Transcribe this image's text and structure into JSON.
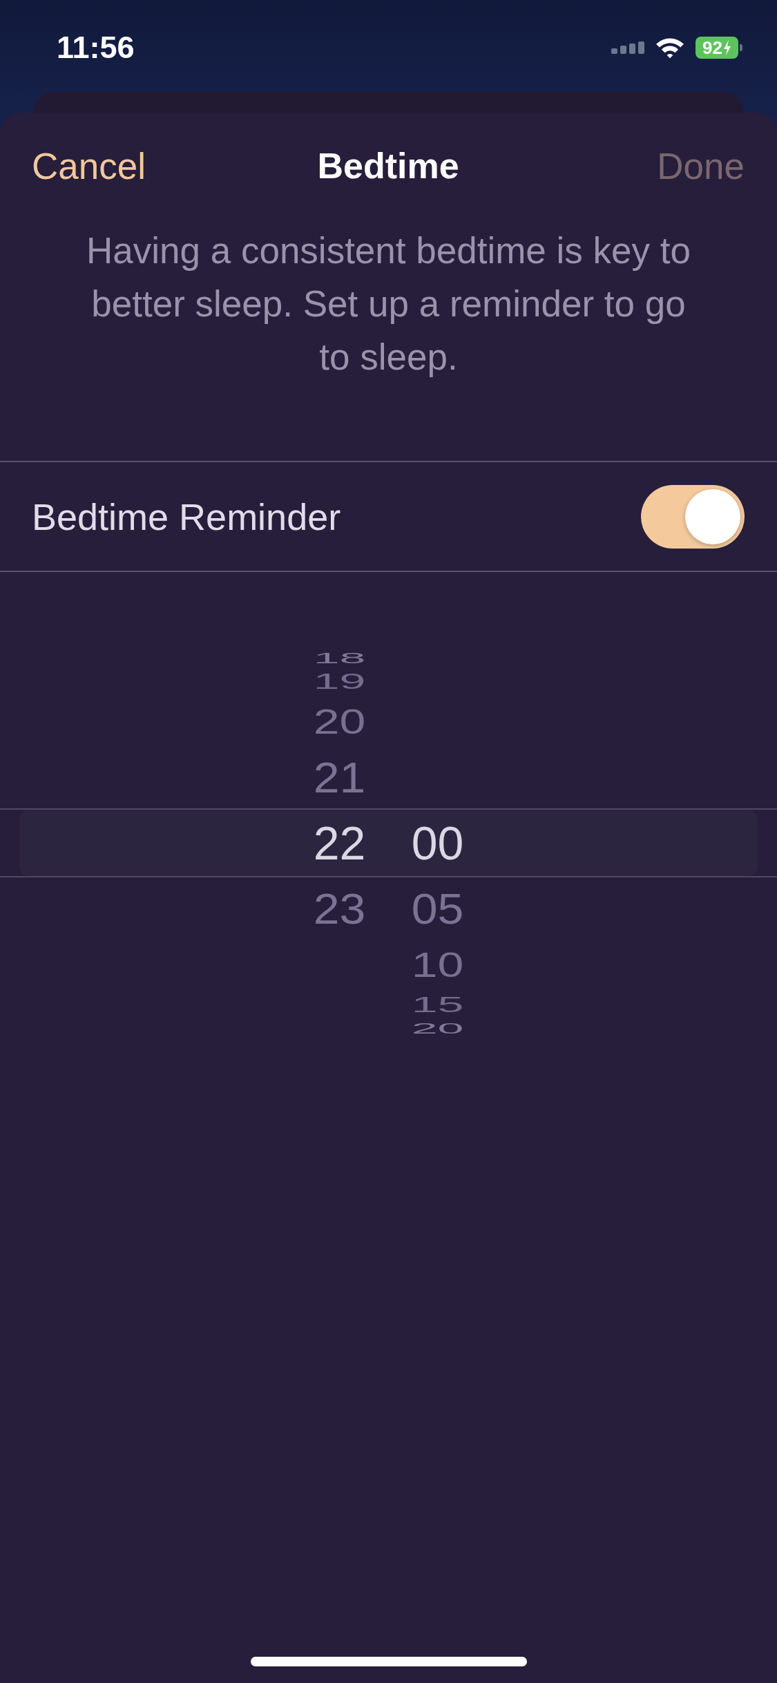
{
  "status_bar": {
    "time": "11:56",
    "battery_percent": "92",
    "charging": true
  },
  "sheet": {
    "cancel": "Cancel",
    "title": "Bedtime",
    "done": {
      "label": "Done",
      "disabled": true
    }
  },
  "description": "Having a consistent bedtime is key to better sleep. Set up a reminder to go to sleep.",
  "reminder": {
    "label": "Bedtime Reminder",
    "on": true
  },
  "picker": {
    "columns": [
      {
        "items": [
          {
            "value": "18",
            "selected": false
          },
          {
            "value": "19",
            "selected": false
          },
          {
            "value": "20",
            "selected": false
          },
          {
            "value": "21",
            "selected": false
          },
          {
            "value": "22",
            "selected": true
          },
          {
            "value": "23",
            "selected": false
          }
        ]
      },
      {
        "items": [
          {
            "value": "00",
            "selected": true
          },
          {
            "value": "05",
            "selected": false
          },
          {
            "value": "10",
            "selected": false
          },
          {
            "value": "15",
            "selected": false
          },
          {
            "value": "20",
            "selected": false
          }
        ]
      }
    ]
  }
}
